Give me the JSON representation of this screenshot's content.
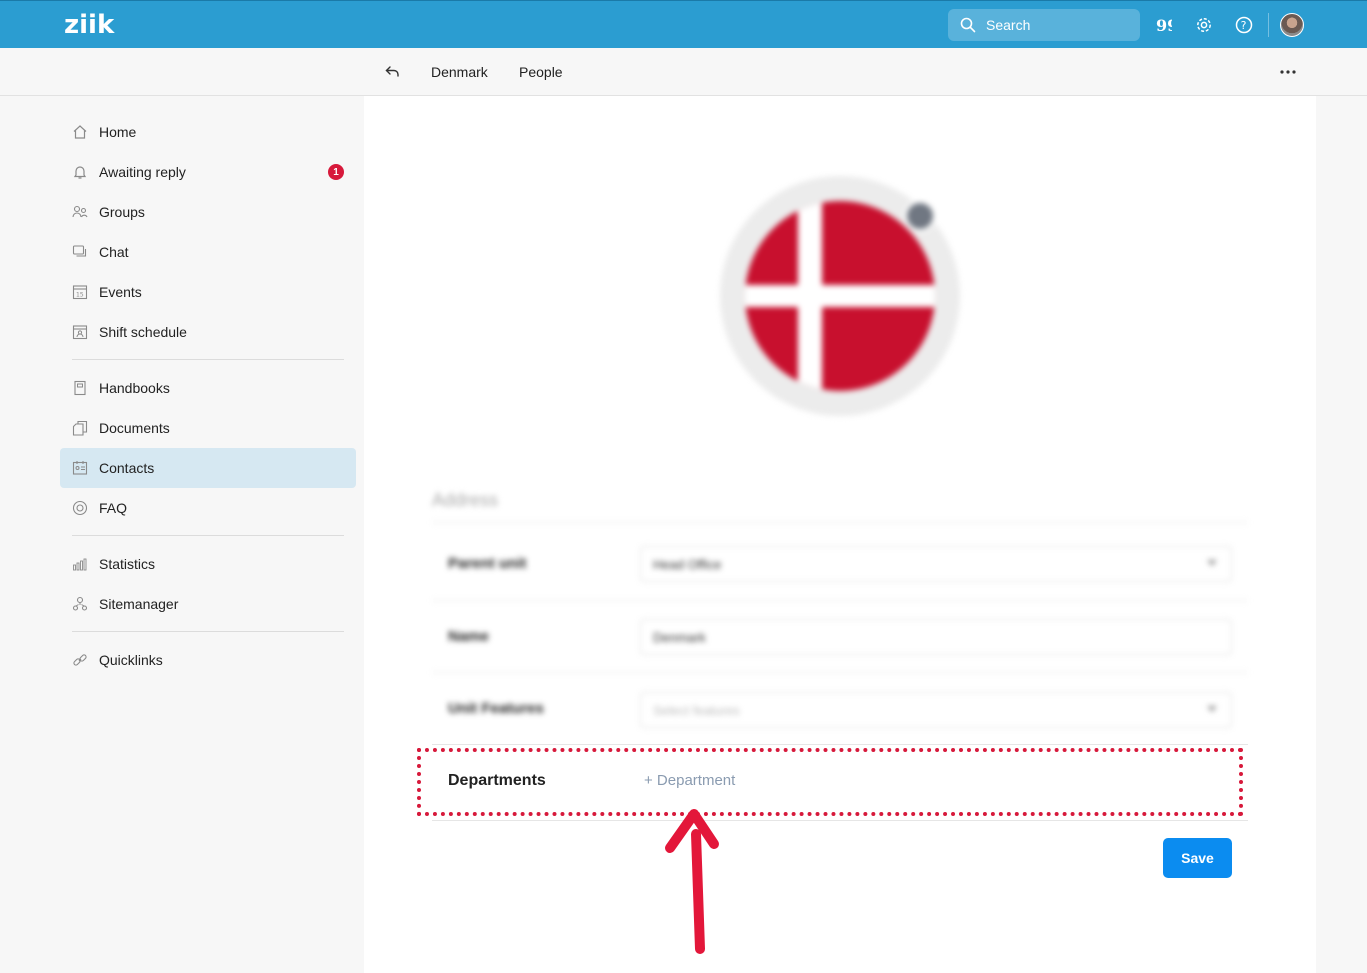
{
  "topbar": {
    "logo": "ziik",
    "search_placeholder": "Search",
    "icons": [
      "quote-icon",
      "gear-icon",
      "help-icon"
    ]
  },
  "subheader": {
    "breadcrumbs": [
      "Denmark",
      "People"
    ]
  },
  "sidebar": {
    "items": [
      {
        "label": "Home",
        "icon": "home-icon"
      },
      {
        "label": "Awaiting reply",
        "icon": "bell-icon",
        "badge": "1"
      },
      {
        "label": "Groups",
        "icon": "groups-icon"
      },
      {
        "label": "Chat",
        "icon": "chat-icon"
      },
      {
        "label": "Events",
        "icon": "calendar-icon",
        "calendar_day": "15"
      },
      {
        "label": "Shift schedule",
        "icon": "shift-icon"
      },
      {
        "label": "Handbooks",
        "icon": "handbook-icon"
      },
      {
        "label": "Documents",
        "icon": "documents-icon"
      },
      {
        "label": "Contacts",
        "icon": "contacts-icon",
        "active": true
      },
      {
        "label": "FAQ",
        "icon": "lifebuoy-icon"
      },
      {
        "label": "Statistics",
        "icon": "statistics-icon"
      },
      {
        "label": "Sitemanager",
        "icon": "sitemap-icon"
      },
      {
        "label": "Quicklinks",
        "icon": "link-icon"
      }
    ]
  },
  "form": {
    "section_title": "Address",
    "parent_unit_label": "Parent unit",
    "parent_unit_value": "Head Office",
    "name_label": "Name",
    "name_value": "Denmark",
    "unit_features_label": "Unit Features",
    "unit_features_placeholder": "Select features",
    "departments_label": "Departments",
    "add_department": "+ Department",
    "save_label": "Save"
  },
  "colors": {
    "topbar": "#2b9dd1",
    "accent_button": "#0b8cf0",
    "highlight": "#d7193b",
    "flag_red": "#c8102e",
    "active_nav": "#d6e8f2"
  }
}
